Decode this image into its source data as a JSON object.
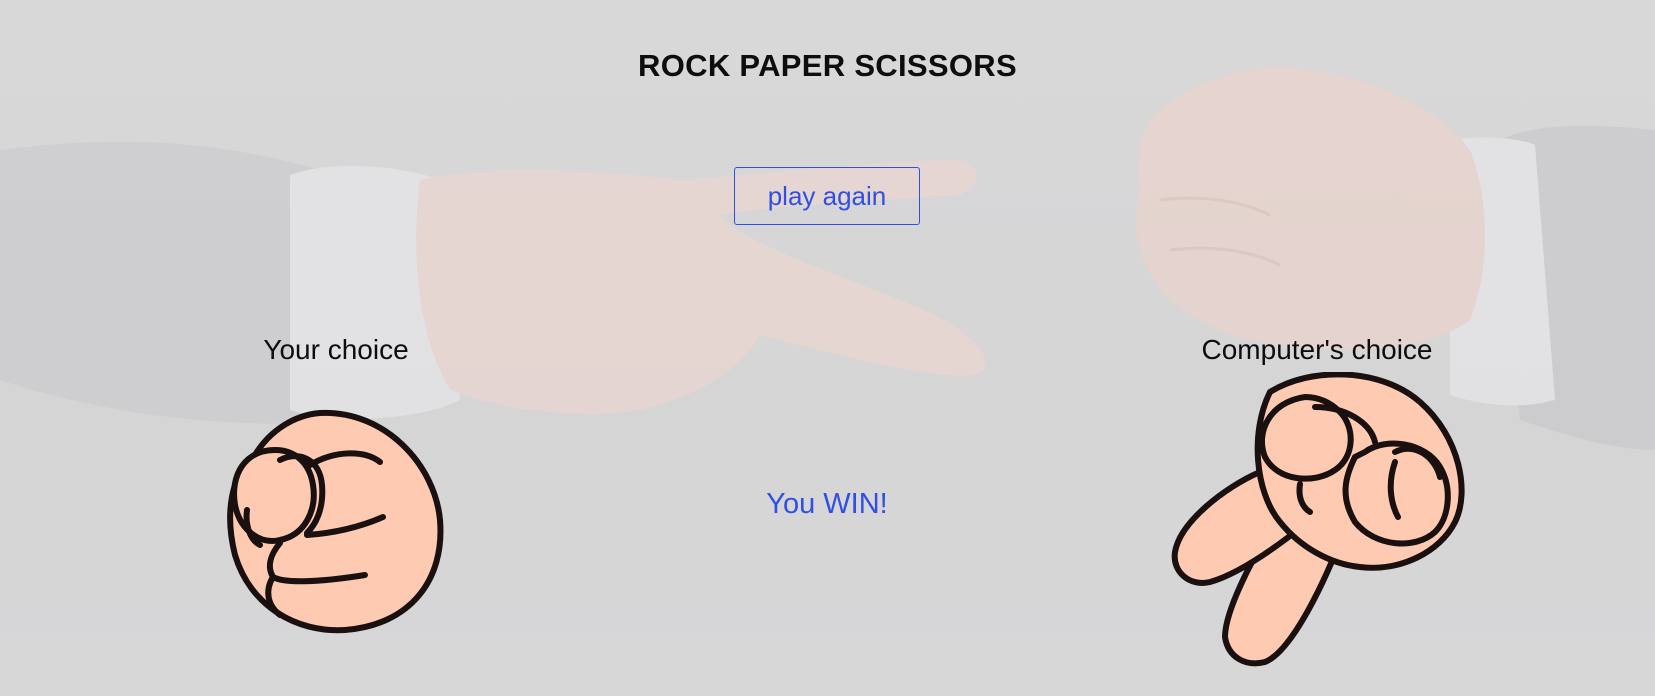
{
  "game": {
    "title": "ROCK PAPER SCISSORS",
    "play_again_label": "play again",
    "player_label": "Your choice",
    "computer_label": "Computer's choice",
    "result_text": "You WIN!",
    "player_choice_icon": "rock-fist-icon",
    "computer_choice_icon": "scissors-hand-icon"
  },
  "colors": {
    "accent": "#2f4fe6",
    "skin": "#fecbb2",
    "outline": "#1a1010",
    "background": "#d6d6d7"
  }
}
